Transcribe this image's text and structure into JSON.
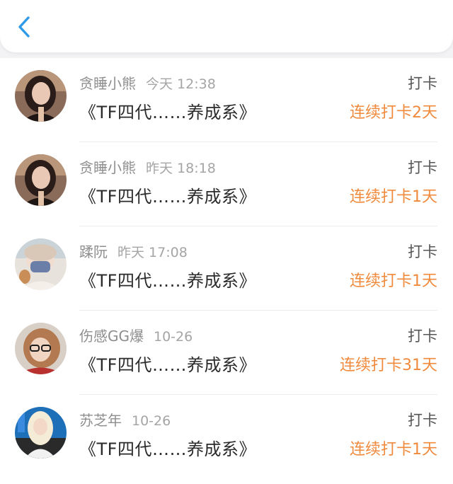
{
  "header": {
    "back_icon": "chevron-left-icon",
    "accent_color": "#2f9be8"
  },
  "colors": {
    "streak": "#f08a3d",
    "username": "#8e8e8e",
    "title": "#2b2b2b"
  },
  "rows": [
    {
      "username": "贪睡小熊",
      "time": "今天 12:38",
      "title": "《TF四代……养成系》",
      "action": "打卡",
      "streak": "连续打卡2天"
    },
    {
      "username": "贪睡小熊",
      "time": "昨天 18:18",
      "title": "《TF四代……养成系》",
      "action": "打卡",
      "streak": "连续打卡1天"
    },
    {
      "username": "蹂阮",
      "time": "昨天 17:08",
      "title": "《TF四代……养成系》",
      "action": "打卡",
      "streak": "连续打卡1天"
    },
    {
      "username": "伤感GG爆",
      "time": "10-26",
      "title": "《TF四代……养成系》",
      "action": "打卡",
      "streak": "连续打卡31天"
    },
    {
      "username": "苏芝年",
      "time": "10-26",
      "title": "《TF四代……养成系》",
      "action": "打卡",
      "streak": "连续打卡1天"
    }
  ]
}
